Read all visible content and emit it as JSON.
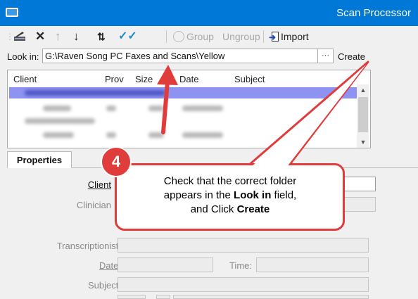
{
  "window": {
    "title": "Scan Processor"
  },
  "toolbar": {
    "scan_icon": "scanner-icon",
    "delete_icon": "x-icon",
    "up_icon": "arrow-up-icon",
    "down_icon": "arrow-down-icon",
    "swap_icon": "swap-icon",
    "check_icon": "double-check-icon",
    "group_label": "Group",
    "ungroup_label": "Ungroup",
    "import_label": "Import"
  },
  "lookin": {
    "label": "Look in:",
    "value": "G:\\Raven Song PC Faxes and Scans\\Yellow",
    "browse_label": "···",
    "create_label": "Create"
  },
  "grid": {
    "columns": [
      "Client",
      "Prov",
      "Size",
      "Date",
      "Subject"
    ]
  },
  "tabs": {
    "properties": "Properties"
  },
  "form": {
    "client_label": "Client",
    "clinician_label": "Clinician",
    "transcriptionist_label": "Transcriptionist:",
    "date_label": "Date:",
    "time_label": "Time:",
    "subject_label": "Subject:"
  },
  "callout": {
    "number": "4",
    "line1": "Check that the correct folder",
    "line2_pre": "appears in the ",
    "line2_bold": "Look in",
    "line2_post": " field,",
    "line3_pre": "and Click ",
    "line3_bold": "Create"
  },
  "colors": {
    "titlebar": "#0078d7",
    "annotation_red": "#e03c3c",
    "selection": "#8e92f0"
  }
}
